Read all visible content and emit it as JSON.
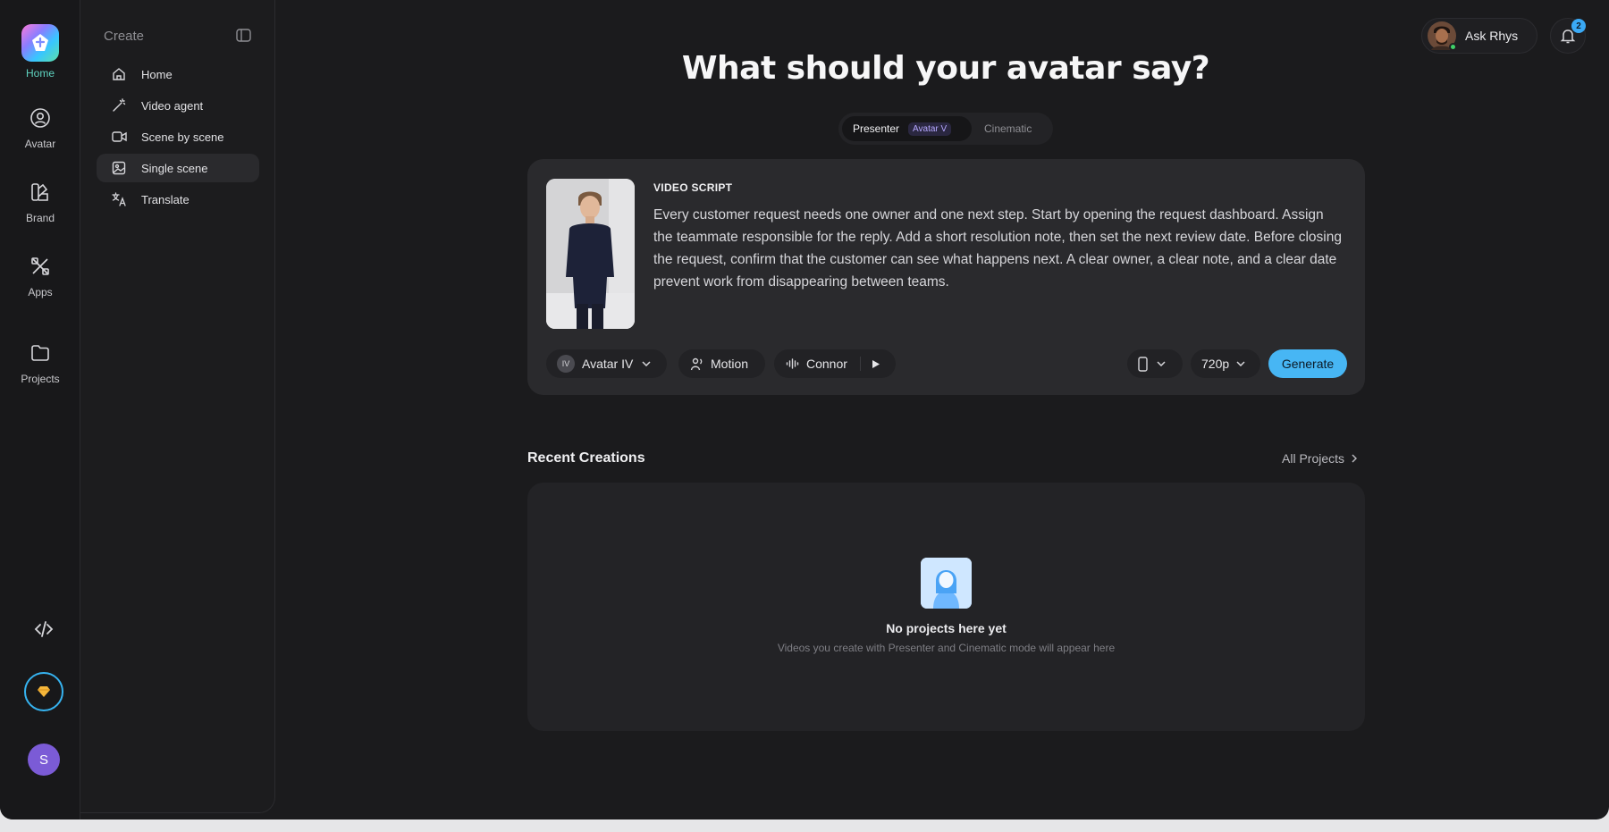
{
  "rail": {
    "home_label": "Home",
    "avatar_label": "Avatar",
    "brand_label": "Brand",
    "apps_label": "Apps",
    "projects_label": "Projects",
    "user_initial": "S"
  },
  "sidebar": {
    "header": "Create",
    "items": [
      {
        "label": "Home",
        "icon": "home-icon"
      },
      {
        "label": "Video agent",
        "icon": "magic-wand-icon"
      },
      {
        "label": "Scene by scene",
        "icon": "video-camera-icon"
      },
      {
        "label": "Single scene",
        "icon": "image-icon"
      },
      {
        "label": "Translate",
        "icon": "translate-icon"
      }
    ],
    "active_index": 3
  },
  "topbar": {
    "ask_label": "Ask Rhys",
    "notification_count": "2"
  },
  "main": {
    "title": "What should your avatar say?",
    "modes": {
      "presenter": "Presenter",
      "presenter_badge": "Avatar V",
      "cinematic": "Cinematic"
    },
    "script": {
      "label": "VIDEO SCRIPT",
      "text": "Every customer request needs one owner and one next step. Start by opening the request dashboard. Assign the teammate responsible for the reply. Add a short resolution note, then set the next review date. Before closing the request, confirm that the customer can see what happens next. A clear owner, a clear note, and a clear date prevent work from disappearing between teams."
    },
    "controls": {
      "avatar_badge": "IV",
      "avatar_model": "Avatar IV",
      "motion": "Motion",
      "voice": "Connor",
      "resolution": "720p",
      "generate": "Generate"
    },
    "recent": {
      "title": "Recent Creations",
      "all_projects": "All Projects",
      "empty_title": "No projects here yet",
      "empty_subtitle": "Videos you create with Presenter and Cinematic mode will appear here"
    }
  },
  "colors": {
    "accent": "#47b6f4",
    "active_rail": "#5fd3c0",
    "background": "#1b1b1d"
  }
}
